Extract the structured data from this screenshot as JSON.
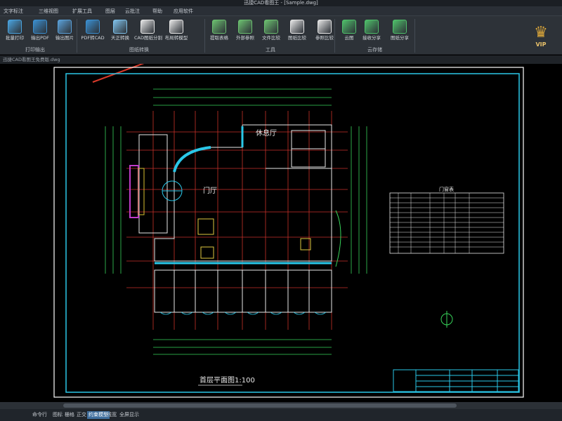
{
  "titlebar": {
    "title": "迅捷CAD看图王 - [Sample.dwg]"
  },
  "menu": [
    "文字标注",
    "三维视图",
    "扩展工具",
    "图层",
    "云批注",
    "帮助",
    "应用软件"
  ],
  "ribbon": {
    "buttons": [
      {
        "label": "批量打印",
        "icon": "print-icon",
        "color": "#4aa3df"
      },
      {
        "label": "输出PDF",
        "icon": "pdf-export-icon",
        "color": "#3b8fd0"
      },
      {
        "label": "输出图片",
        "icon": "image-export-icon",
        "color": "#5aa0d8"
      },
      {
        "label": "PDF转CAD",
        "icon": "pdf-to-cad-icon",
        "color": "#3b8fd0"
      },
      {
        "label": "天正转换",
        "icon": "tz-convert-icon",
        "color": "#7fc1ea"
      },
      {
        "label": "CAD图纸分割",
        "icon": "drawing-split-icon",
        "color": "#e6e6e6"
      },
      {
        "label": "布局转模型",
        "icon": "layout-to-model-icon",
        "color": "#e6e6e6"
      },
      {
        "label": "提取表格",
        "icon": "extract-table-icon",
        "color": "#6cc070"
      },
      {
        "label": "外部参照",
        "icon": "xref-icon",
        "color": "#6cc070"
      },
      {
        "label": "文件比较",
        "icon": "file-compare-icon",
        "color": "#6cc070"
      },
      {
        "label": "图纸比较",
        "icon": "drawing-compare-icon",
        "color": "#e6e6e6"
      },
      {
        "label": "参照比较",
        "icon": "ref-compare-icon",
        "color": "#e6e6e6"
      },
      {
        "label": "云图",
        "icon": "cloud-icon",
        "color": "#4fc06a"
      },
      {
        "label": "接收分享",
        "icon": "receive-share-icon",
        "color": "#4fc06a"
      },
      {
        "label": "图纸分享",
        "icon": "drawing-share-icon",
        "color": "#4fc06a"
      }
    ],
    "groups": [
      "打印输出",
      "图纸转换",
      "工具",
      "云存储"
    ]
  },
  "vip": {
    "label": "VIP"
  },
  "filepath": "迅捷CAD看图王免费版.dwg",
  "drawing": {
    "room_lounge": "休息厅",
    "room_hall": "门厅",
    "caption": "首层平面图1:100",
    "schedule_title": "门窗表"
  },
  "statusbar": {
    "items": [
      "命令行",
      "图标",
      "栅格",
      "正交",
      "约束模型",
      "线宽",
      "全屏显示"
    ],
    "active_index": 4
  }
}
